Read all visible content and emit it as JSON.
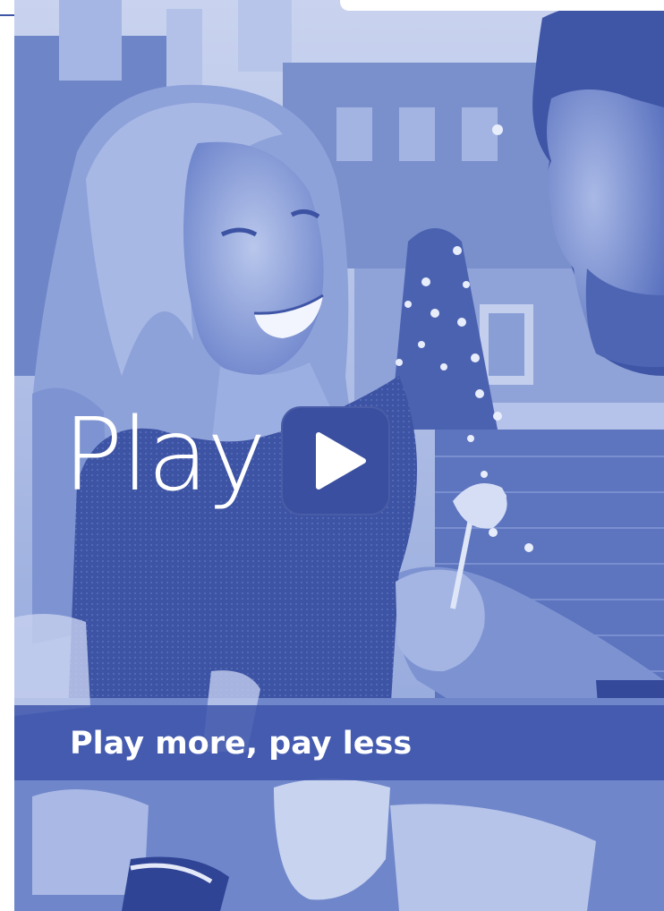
{
  "brand": {
    "logo_text": "Play",
    "play_icon": "play-triangle-icon"
  },
  "tagline": "Play more, pay less",
  "colors": {
    "duotone_dark": "#3a4fa0",
    "duotone_mid": "#5f77c4",
    "duotone_light": "#c9d3ef",
    "text": "#ffffff"
  }
}
